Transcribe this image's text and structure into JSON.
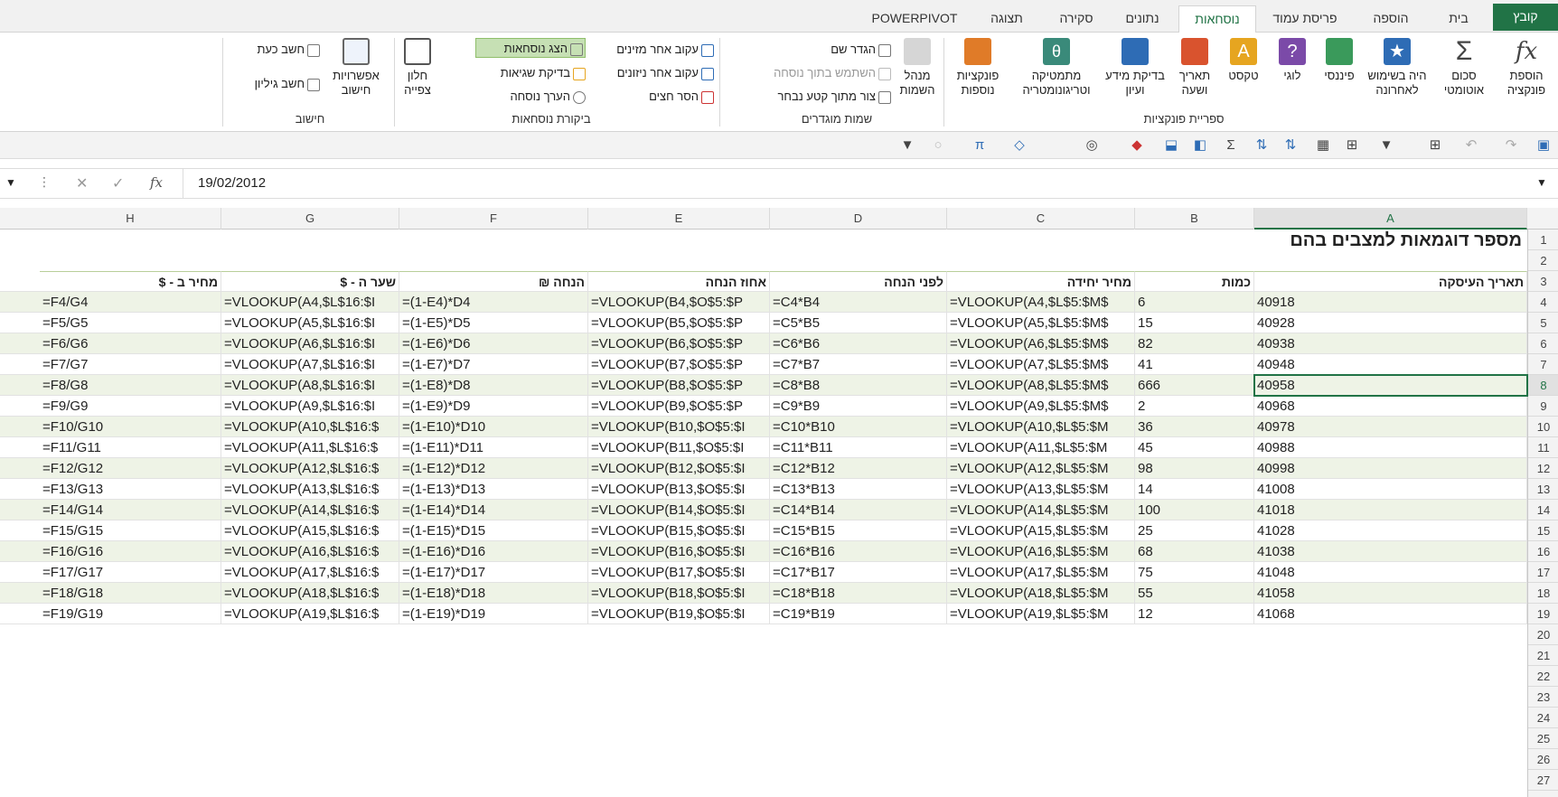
{
  "tabs": [
    "קובץ",
    "בית",
    "הוספה",
    "פריסת עמוד",
    "נוסחאות",
    "נתונים",
    "סקירה",
    "תצוגה",
    "POWERPIVOT"
  ],
  "ribbon": {
    "function_library": {
      "insert_function": "הוספת פונקציה",
      "autosum": "סכום אוטומטי",
      "recently_used": "היה בשימוש לאחרונה",
      "financial": "פיננסי",
      "logical": "לוגי",
      "text": "טקסט",
      "date_time": "תאריך ושעה",
      "lookup": "בדיקת מידע ועיון",
      "math": "מתמטיקה וטריגונומטריה",
      "more": "פונקציות נוספות",
      "group_label": "ספריית פונקציות"
    },
    "defined_names": {
      "name_manager": "מנהל השמות",
      "define_name": "הגדר שם",
      "use_in_formula": "השתמש בתוך נוסחה",
      "create_from_selection": "צור מתוך קטע נבחר",
      "group_label": "שמות מוגדרים"
    },
    "formula_auditing": {
      "trace_precedents": "עקוב אחר מזינים",
      "trace_dependents": "עקוב אחר ניזונים",
      "remove_arrows": "הסר חצים",
      "show_formulas": "הצג נוסחאות",
      "error_checking": "בדיקת שגיאות",
      "evaluate_formula": "הערך נוסחה",
      "watch_window": "חלון צפייה",
      "group_label": "ביקורת נוסחאות"
    },
    "calculation": {
      "options": "אפשרויות חישוב",
      "calc_now": "חשב כעת",
      "calc_sheet": "חשב גיליון",
      "group_label": "חישוב"
    }
  },
  "formula_bar": {
    "value": "19/02/2012",
    "fx": "fx"
  },
  "columns": [
    "A",
    "B",
    "C",
    "D",
    "E",
    "F",
    "G",
    "H"
  ],
  "sheet": {
    "title": "מספר דוגמאות למצבים בהם",
    "headers": {
      "A": "תאריך העיסקה",
      "B": "כמות",
      "C": "מחיר יחידה",
      "D": "לפני הנחה",
      "E": "אחוז הנחה",
      "F": "הנחה ₪",
      "G": "שער ה - $",
      "H": "מחיר ב - $"
    },
    "rows": [
      {
        "r": "4",
        "A": "40918",
        "B": "6",
        "C": "=VLOOKUP(A4,$L$5:$M$",
        "D": "=C4*B4",
        "E": "=VLOOKUP(B4,$O$5:$P",
        "F": "=(1-E4)*D4",
        "G": "=VLOOKUP(A4,$L$16:$I",
        "H": "=F4/G4"
      },
      {
        "r": "5",
        "A": "40928",
        "B": "15",
        "C": "=VLOOKUP(A5,$L$5:$M$",
        "D": "=C5*B5",
        "E": "=VLOOKUP(B5,$O$5:$P",
        "F": "=(1-E5)*D5",
        "G": "=VLOOKUP(A5,$L$16:$I",
        "H": "=F5/G5"
      },
      {
        "r": "6",
        "A": "40938",
        "B": "82",
        "C": "=VLOOKUP(A6,$L$5:$M$",
        "D": "=C6*B6",
        "E": "=VLOOKUP(B6,$O$5:$P",
        "F": "=(1-E6)*D6",
        "G": "=VLOOKUP(A6,$L$16:$I",
        "H": "=F6/G6"
      },
      {
        "r": "7",
        "A": "40948",
        "B": "41",
        "C": "=VLOOKUP(A7,$L$5:$M$",
        "D": "=C7*B7",
        "E": "=VLOOKUP(B7,$O$5:$P",
        "F": "=(1-E7)*D7",
        "G": "=VLOOKUP(A7,$L$16:$I",
        "H": "=F7/G7"
      },
      {
        "r": "8",
        "A": "40958",
        "B": "666",
        "C": "=VLOOKUP(A8,$L$5:$M$",
        "D": "=C8*B8",
        "E": "=VLOOKUP(B8,$O$5:$P",
        "F": "=(1-E8)*D8",
        "G": "=VLOOKUP(A8,$L$16:$I",
        "H": "=F8/G8"
      },
      {
        "r": "9",
        "A": "40968",
        "B": "2",
        "C": "=VLOOKUP(A9,$L$5:$M$",
        "D": "=C9*B9",
        "E": "=VLOOKUP(B9,$O$5:$P",
        "F": "=(1-E9)*D9",
        "G": "=VLOOKUP(A9,$L$16:$I",
        "H": "=F9/G9"
      },
      {
        "r": "10",
        "A": "40978",
        "B": "36",
        "C": "=VLOOKUP(A10,$L$5:$M",
        "D": "=C10*B10",
        "E": "=VLOOKUP(B10,$O$5:$I",
        "F": "=(1-E10)*D10",
        "G": "=VLOOKUP(A10,$L$16:$",
        "H": "=F10/G10"
      },
      {
        "r": "11",
        "A": "40988",
        "B": "45",
        "C": "=VLOOKUP(A11,$L$5:$M",
        "D": "=C11*B11",
        "E": "=VLOOKUP(B11,$O$5:$I",
        "F": "=(1-E11)*D11",
        "G": "=VLOOKUP(A11,$L$16:$",
        "H": "=F11/G11"
      },
      {
        "r": "12",
        "A": "40998",
        "B": "98",
        "C": "=VLOOKUP(A12,$L$5:$M",
        "D": "=C12*B12",
        "E": "=VLOOKUP(B12,$O$5:$I",
        "F": "=(1-E12)*D12",
        "G": "=VLOOKUP(A12,$L$16:$",
        "H": "=F12/G12"
      },
      {
        "r": "13",
        "A": "41008",
        "B": "14",
        "C": "=VLOOKUP(A13,$L$5:$M",
        "D": "=C13*B13",
        "E": "=VLOOKUP(B13,$O$5:$I",
        "F": "=(1-E13)*D13",
        "G": "=VLOOKUP(A13,$L$16:$",
        "H": "=F13/G13"
      },
      {
        "r": "14",
        "A": "41018",
        "B": "100",
        "C": "=VLOOKUP(A14,$L$5:$M",
        "D": "=C14*B14",
        "E": "=VLOOKUP(B14,$O$5:$I",
        "F": "=(1-E14)*D14",
        "G": "=VLOOKUP(A14,$L$16:$",
        "H": "=F14/G14"
      },
      {
        "r": "15",
        "A": "41028",
        "B": "25",
        "C": "=VLOOKUP(A15,$L$5:$M",
        "D": "=C15*B15",
        "E": "=VLOOKUP(B15,$O$5:$I",
        "F": "=(1-E15)*D15",
        "G": "=VLOOKUP(A15,$L$16:$",
        "H": "=F15/G15"
      },
      {
        "r": "16",
        "A": "41038",
        "B": "68",
        "C": "=VLOOKUP(A16,$L$5:$M",
        "D": "=C16*B16",
        "E": "=VLOOKUP(B16,$O$5:$I",
        "F": "=(1-E16)*D16",
        "G": "=VLOOKUP(A16,$L$16:$",
        "H": "=F16/G16"
      },
      {
        "r": "17",
        "A": "41048",
        "B": "75",
        "C": "=VLOOKUP(A17,$L$5:$M",
        "D": "=C17*B17",
        "E": "=VLOOKUP(B17,$O$5:$I",
        "F": "=(1-E17)*D17",
        "G": "=VLOOKUP(A17,$L$16:$",
        "H": "=F17/G17"
      },
      {
        "r": "18",
        "A": "41058",
        "B": "55",
        "C": "=VLOOKUP(A18,$L$5:$M",
        "D": "=C18*B18",
        "E": "=VLOOKUP(B18,$O$5:$I",
        "F": "=(1-E18)*D18",
        "G": "=VLOOKUP(A18,$L$16:$",
        "H": "=F18/G18"
      },
      {
        "r": "19",
        "A": "41068",
        "B": "12",
        "C": "=VLOOKUP(A19,$L$5:$M",
        "D": "=C19*B19",
        "E": "=VLOOKUP(B19,$O$5:$I",
        "F": "=(1-E19)*D19",
        "G": "=VLOOKUP(A19,$L$16:$",
        "H": "=F19/G19"
      }
    ],
    "row_numbers": [
      "1",
      "2",
      "3",
      "4",
      "5",
      "6",
      "7",
      "8",
      "9",
      "10",
      "11",
      "12",
      "13",
      "14",
      "15",
      "16",
      "17",
      "18",
      "19",
      "20",
      "21",
      "22",
      "23",
      "24",
      "25",
      "26",
      "27"
    ],
    "selected_cell": "A8"
  },
  "colors": {
    "accent": "#217346",
    "band": "#eef3e6"
  }
}
